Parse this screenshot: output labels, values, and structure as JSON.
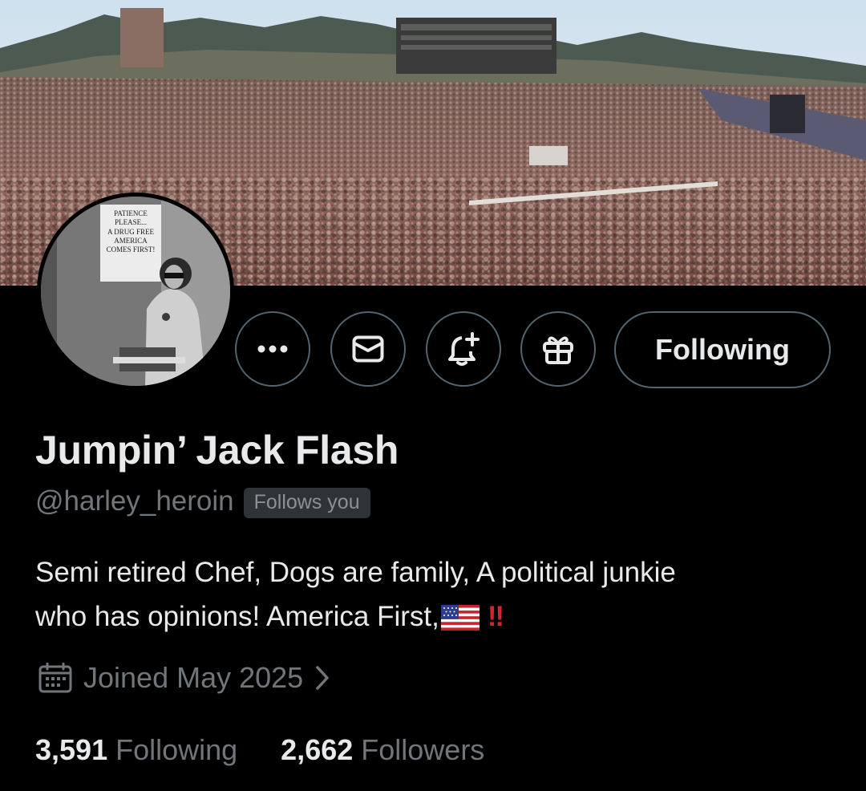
{
  "profile": {
    "display_name": "Jumpin’ Jack Flash",
    "handle": "@harley_heroin",
    "follows_you_badge": "Follows you",
    "bio_line1": "Semi retired Chef,  Dogs are family, A political junkie",
    "bio_line2": "who has opinions!  America First,",
    "bio_emoji_flag": "us-flag-emoji",
    "bio_emoji_bang": "‼",
    "joined": "Joined May 2025",
    "following_count": "3,591",
    "following_label": "Following",
    "followers_count": "2,662",
    "followers_label": "Followers"
  },
  "avatar": {
    "sign_lines": [
      "PATIENCE",
      "PLEASE...",
      "A DRUG FREE",
      "AMERICA",
      "COMES FIRST!"
    ]
  },
  "actions": {
    "more_icon": "more-horizontal-icon",
    "message_icon": "envelope-icon",
    "notify_icon": "bell-plus-icon",
    "gift_icon": "gift-icon",
    "follow_button_label": "Following"
  },
  "colors": {
    "background": "#000000",
    "primary_text": "#e7e9ea",
    "secondary_text": "#71767b",
    "button_border": "#536471",
    "badge_bg": "#2f3336",
    "bang_red": "#d3242c"
  }
}
